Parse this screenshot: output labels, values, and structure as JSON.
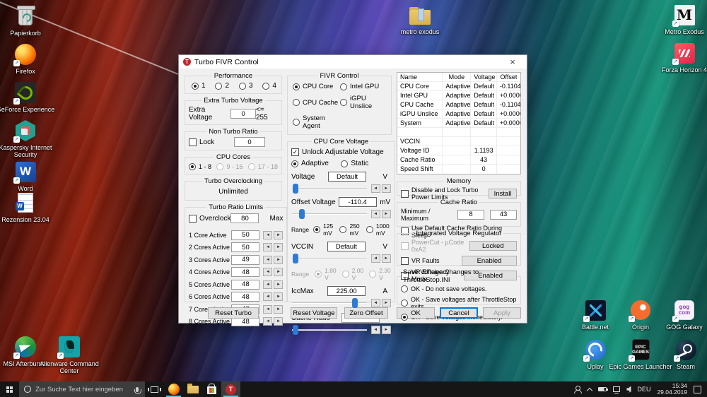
{
  "desktop": {
    "icons": [
      {
        "label": "Papierkorb",
        "icon": "recycle-bin"
      },
      {
        "label": "Firefox",
        "icon": "firefox"
      },
      {
        "label": "GeForce Experience",
        "icon": "geforce-experience"
      },
      {
        "label": "Kaspersky Internet Security",
        "icon": "kaspersky"
      },
      {
        "label": "Word",
        "icon": "word"
      },
      {
        "label": "Rezension 23.04",
        "icon": "word-document"
      },
      {
        "label": "MSI Afterburner",
        "icon": "msi-afterburner"
      },
      {
        "label": "Alienware Command Center",
        "icon": "alienware"
      },
      {
        "label": "metro exodus",
        "icon": "folder"
      },
      {
        "label": "Metro Exodus",
        "icon": "metro-exodus"
      },
      {
        "label": "Forza Horizon 4",
        "icon": "forza-horizon-4"
      },
      {
        "label": "Battle.net",
        "icon": "battlenet"
      },
      {
        "label": "Origin",
        "icon": "origin"
      },
      {
        "label": "GOG Galaxy",
        "icon": "gog-galaxy"
      },
      {
        "label": "Uplay",
        "icon": "uplay"
      },
      {
        "label": "Epic Games Launcher",
        "icon": "epic-games"
      },
      {
        "label": "Steam",
        "icon": "steam"
      }
    ]
  },
  "dialog": {
    "title": "Turbo FIVR Control",
    "performance": {
      "title": "Performance",
      "options": [
        "1",
        "2",
        "3",
        "4"
      ],
      "selected": "1"
    },
    "extra_turbo_voltage": {
      "title": "Extra Turbo Voltage",
      "field_label": "Extra Voltage",
      "value": "0",
      "hint": "<= 255"
    },
    "non_turbo_ratio": {
      "title": "Non Turbo Ratio",
      "lock_label": "Lock",
      "value": "0"
    },
    "cpu_cores": {
      "title": "CPU Cores",
      "options": [
        "1 - 8",
        "9 - 16",
        "17 - 18"
      ],
      "selected": "1 - 8"
    },
    "turbo_overclocking": {
      "title": "Turbo Overclocking",
      "value": "Unlimited"
    },
    "turbo_ratio_limits": {
      "title": "Turbo Ratio Limits",
      "overclock_label": "Overclock",
      "max_value": "80",
      "max_label": "Max",
      "rows": [
        {
          "label": "1 Core Active",
          "value": "50"
        },
        {
          "label": "2 Cores Active",
          "value": "50"
        },
        {
          "label": "3 Cores Active",
          "value": "49"
        },
        {
          "label": "4 Cores Active",
          "value": "48"
        },
        {
          "label": "5 Cores Active",
          "value": "48"
        },
        {
          "label": "6 Cores Active",
          "value": "48"
        },
        {
          "label": "7 Cores Active",
          "value": "48"
        },
        {
          "label": "8 Cores Active",
          "value": "48"
        }
      ]
    },
    "reset_turbo_label": "Reset Turbo",
    "fivr_control": {
      "title": "FIVR Control",
      "options": [
        "CPU Core",
        "Intel GPU",
        "CPU Cache",
        "iGPU Unslice",
        "System Agent"
      ],
      "selected": "CPU Core"
    },
    "cpu_core_voltage": {
      "title": "CPU Core Voltage",
      "unlock_label": "Unlock Adjustable Voltage",
      "mode_options": [
        "Adaptive",
        "Static"
      ],
      "mode_selected": "Adaptive",
      "voltage_label": "Voltage",
      "voltage_value": "Default",
      "voltage_unit": "V",
      "offset_label": "Offset Voltage",
      "offset_value": "-110.4",
      "offset_unit": "mV",
      "range_mv_label": "Range",
      "range_mv_options": [
        "125 mV",
        "250 mV",
        "1000 mV"
      ],
      "range_mv_selected": "125 mV",
      "vccin_label": "VCCIN",
      "vccin_value": "Default",
      "vccin_unit": "V",
      "range_v_label": "Range",
      "range_v_options": [
        "1.80 V",
        "2.00 V",
        "2.30 V"
      ],
      "range_v_selected": "1.80 V",
      "iccmax_label": "IccMax",
      "iccmax_value": "225.00",
      "iccmax_unit": "A",
      "cache_ratio_label": "Cache Ratio",
      "cache_ratio_value": ""
    },
    "reset_voltage_label": "Reset Voltage",
    "zero_offset_label": "Zero Offset",
    "status_table": {
      "headers": [
        "Name",
        "Mode",
        "Voltage",
        "Offset"
      ],
      "rows": [
        [
          "CPU Core",
          "Adaptive",
          "Default",
          "-0.1104"
        ],
        [
          "Intel GPU",
          "Adaptive",
          "Default",
          "+0.0000"
        ],
        [
          "CPU Cache",
          "Adaptive",
          "Default",
          "-0.1104"
        ],
        [
          "iGPU Unslice",
          "Adaptive",
          "Default",
          "+0.0000"
        ],
        [
          "System Agent",
          "Adaptive",
          "Default",
          "+0.0000"
        ],
        [
          "",
          "",
          "",
          ""
        ],
        [
          "VCCIN",
          "",
          "",
          ""
        ],
        [
          "Voltage ID",
          "",
          "1.1193",
          ""
        ],
        [
          "Cache Ratio",
          "",
          "43",
          ""
        ],
        [
          "Speed Shift EPP",
          "",
          "0",
          ""
        ]
      ]
    },
    "memory": {
      "title": "Memory",
      "checkbox_label": "Disable and Lock Turbo Power Limits",
      "button_label": "Install"
    },
    "cache_ratio_group": {
      "title": "Cache Ratio",
      "minmax_label": "Minimum / Maximum",
      "min_value": "8",
      "max_value": "43",
      "sleep_label": "Use Default Cache Ratio During Sleep"
    },
    "ivr": {
      "title": "Integrated Voltage Regulator",
      "rows": [
        {
          "label": "PowerCut  -  µCode 0xA2",
          "button": "Locked"
        },
        {
          "label": "VR Faults",
          "button": "Enabled"
        },
        {
          "label": "VR Efficiency Mode",
          "button": "Enabled"
        }
      ]
    },
    "save_group": {
      "title": "Save Voltage Changes to ThrottleStop.INI",
      "options": [
        "OK - Do not save voltages.",
        "OK - Save voltages after ThrottleStop exits.",
        "OK - Save voltages immediately."
      ],
      "selected": "OK - Save voltages immediately."
    },
    "buttons": {
      "ok": "OK",
      "cancel": "Cancel",
      "apply": "Apply"
    }
  },
  "taskbar": {
    "search_placeholder": "Zur Suche Text hier eingeben",
    "language": "DEU",
    "time": "15:34",
    "date": "29.04.2019"
  },
  "colors": {
    "accent": "#0078d7",
    "slider_thumb": "#2e7bd6",
    "title_icon_red": "#c0272d",
    "taskbar_underline": "#58c6d6"
  },
  "icons": {
    "close-icon": "×",
    "chevron-up-icon": "∧",
    "spinner-left-icon": "◄",
    "spinner-right-icon": "►",
    "check-icon": "✓",
    "shortcut-arrow-icon": "↗"
  }
}
